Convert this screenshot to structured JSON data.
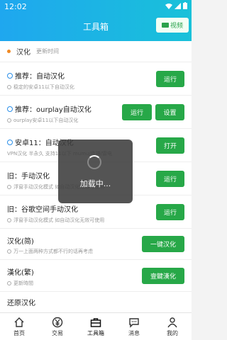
{
  "status": {
    "time": "12:02",
    "icons": [
      "sim-icon",
      "wifi-icon",
      "signal-icon",
      "battery-icon"
    ]
  },
  "header": {
    "title": "工具箱",
    "video_label": "视频"
  },
  "topline": {
    "name": "汉化",
    "time": "更新时间"
  },
  "items": [
    {
      "title": "推荐：自动汉化",
      "subtitle": "稳定的安卓11以下自动汉化",
      "buttons": [
        "运行"
      ]
    },
    {
      "title": "推荐：ourplay自动汉化",
      "subtitle": "ourplay安卓11以下自动汉化",
      "buttons": [
        "运行",
        "设置"
      ]
    },
    {
      "title": "安卓11：自动汉化",
      "subtitle": "VPN汉化 半永久 支持11以下 mumu/夜神/雷电",
      "buttons": [
        "打开"
      ]
    },
    {
      "title": "旧：手动汉化",
      "subtitle": "浮窗手动汉化模式 如自动汉化无效可使用",
      "buttons": [
        "运行"
      ]
    },
    {
      "title": "旧：谷歌空间手动汉化",
      "subtitle": "浮窗手动汉化模式 如自动汉化无效可使用",
      "buttons": [
        "运行"
      ]
    },
    {
      "title": "汉化(简)",
      "subtitle": "万一上面两种方式都不行的话再考虑",
      "buttons": [
        "一键汉化"
      ]
    },
    {
      "title": "漢化(繁)",
      "subtitle": "更新時間",
      "buttons": [
        "壹鍵漢化"
      ]
    },
    {
      "title": "还原汉化",
      "subtitle": "",
      "buttons": []
    }
  ],
  "loading": {
    "text": "加载中..."
  },
  "nav": [
    {
      "label": "首页",
      "icon": "home-icon"
    },
    {
      "label": "交易",
      "icon": "yen-icon"
    },
    {
      "label": "工具箱",
      "icon": "toolbox-icon"
    },
    {
      "label": "消息",
      "icon": "message-icon"
    },
    {
      "label": "我的",
      "icon": "user-icon"
    }
  ],
  "colors": {
    "accent": "#27a848",
    "header_start": "#1fa7ef",
    "header_end": "#19c1d9",
    "dot": "#f08a24"
  }
}
